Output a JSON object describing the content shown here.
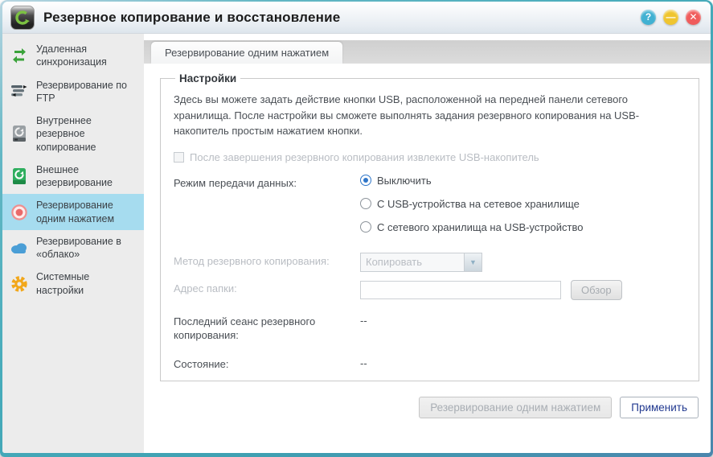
{
  "window": {
    "title": "Резервное копирование и восстановление",
    "controls": {
      "help": "?",
      "minimize": "—",
      "close": "✕"
    }
  },
  "sidebar": {
    "items": [
      {
        "label": "Удаленная синхронизация",
        "icon": "remote-sync-icon",
        "selected": false
      },
      {
        "label": "Резервирование по FTP",
        "icon": "ftp-server-icon",
        "selected": false
      },
      {
        "label": "Внутреннее резервное копирование",
        "icon": "internal-backup-drive-icon",
        "selected": false
      },
      {
        "label": "Внешнее резервирование",
        "icon": "external-backup-drive-icon",
        "selected": false
      },
      {
        "label": "Резервирование одним нажатием",
        "icon": "one-touch-button-icon",
        "selected": true
      },
      {
        "label": "Резервирование в «облако»",
        "icon": "cloud-icon",
        "selected": false
      },
      {
        "label": "Системные настройки",
        "icon": "gear-icon",
        "selected": false
      }
    ],
    "selected_color": "#a6dcef"
  },
  "main": {
    "tab": "Резервирование одним нажатием",
    "settings": {
      "legend": "Настройки",
      "description": "Здесь вы можете задать действие кнопки USB, расположенной на передней панели сетевого хранилища. После настройки вы сможете выполнять задания резервного копирования на USB-накопитель простым нажатием кнопки.",
      "eject_checkbox": {
        "label": "После завершения резервного копирования извлеките USB-накопитель",
        "checked": false,
        "disabled": true
      },
      "transfer_mode": {
        "label": "Режим передачи данных:",
        "options": [
          "Выключить",
          "С USB-устройства на сетевое хранилище",
          "С сетевого хранилища на USB-устройство"
        ],
        "selected": "Выключить"
      },
      "backup_method": {
        "label": "Метод резервного копирования:",
        "value": "Копировать",
        "disabled": true
      },
      "folder": {
        "label": "Адрес папки:",
        "value": "",
        "browse_label": "Обзор",
        "disabled": true
      },
      "last_backup": {
        "label": "Последний сеанс резервного копирования:",
        "value": "--"
      },
      "status": {
        "label": "Состояние:",
        "value": "--"
      }
    },
    "buttons": {
      "one_touch": {
        "label": "Резервирование одним нажатием",
        "disabled": true
      },
      "apply": {
        "label": "Применить",
        "disabled": false
      }
    },
    "accent_colors": {
      "radio": "#2f76c9",
      "apply_text": "#20388f",
      "frame": "#46abba"
    }
  }
}
